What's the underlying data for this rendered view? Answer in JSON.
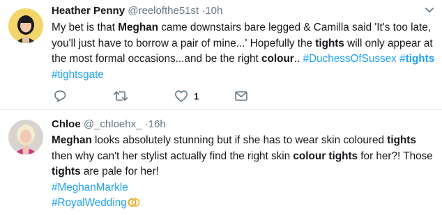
{
  "tweets": [
    {
      "name": "Heather Penny",
      "handle": "@reelofthe51st",
      "separator": "·",
      "time": "10h",
      "segments": [
        {
          "text": "My bet is that "
        },
        {
          "text": "Meghan",
          "bold": true
        },
        {
          "text": " came downstairs bare legged & Camilla said 'It's too late, you'll just have to borrow a pair of mine...' Hopefully the "
        },
        {
          "text": "tights",
          "bold": true
        },
        {
          "text": " will only appear at the most formal occasions...and be the right "
        },
        {
          "text": "colour",
          "bold": true
        },
        {
          "text": ".. "
        },
        {
          "text": "#DuchessOfSussex",
          "tag": true
        },
        {
          "text": " "
        },
        {
          "text": "#",
          "tag": true
        },
        {
          "text": "tights",
          "tag": true,
          "bold": true
        },
        {
          "text": " "
        },
        {
          "text": "#tightsgate",
          "tag": true
        }
      ],
      "likes": "1"
    },
    {
      "name": "Chloe",
      "handle": "@_chloehx_",
      "separator": "·",
      "time": "16h",
      "segments": [
        {
          "text": "Meghan",
          "bold": true
        },
        {
          "text": " looks absolutely stunning but if she has to wear skin coloured "
        },
        {
          "text": "tights",
          "bold": true
        },
        {
          "text": " then why can't her stylist actually find the right skin "
        },
        {
          "text": "colour tights",
          "bold": true
        },
        {
          "text": " for her?! Those "
        },
        {
          "text": "tights",
          "bold": true
        },
        {
          "text": " are pale for her!"
        },
        {
          "break": true
        },
        {
          "text": "#MeghanMarkle",
          "tag": true
        },
        {
          "break": true
        },
        {
          "text": "#RoyalWedding",
          "tag": true
        },
        {
          "emoji": "wedding-rings-icon"
        }
      ]
    }
  ],
  "colors": {
    "link": "#1da1f2",
    "muted": "#657786",
    "text": "#14171a"
  },
  "icons": [
    "chevron-down-icon",
    "reply-icon",
    "retweet-icon",
    "like-icon",
    "message-icon",
    "wedding-rings-icon"
  ]
}
